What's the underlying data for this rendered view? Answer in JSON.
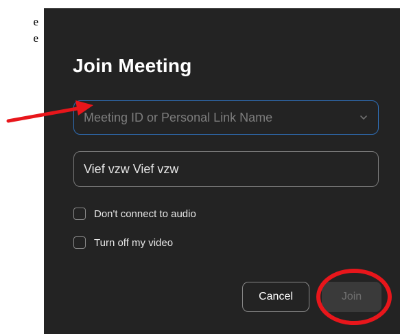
{
  "background": {
    "fragment_lines": [
      "e",
      "e"
    ]
  },
  "dialog": {
    "title": "Join Meeting",
    "meeting_id": {
      "value": "",
      "placeholder": "Meeting ID or Personal Link Name"
    },
    "name_field": {
      "value": "Vief vzw Vief vzw"
    },
    "options": [
      {
        "label": "Don't connect to audio",
        "checked": false
      },
      {
        "label": "Turn off my video",
        "checked": false
      }
    ],
    "cancel_label": "Cancel",
    "join_label": "Join"
  },
  "annotations": {
    "arrow_color": "#e8161b",
    "circle_color": "#e8161b"
  },
  "colors": {
    "dialog_bg": "#232323",
    "focus_border": "#2f6fb8"
  }
}
